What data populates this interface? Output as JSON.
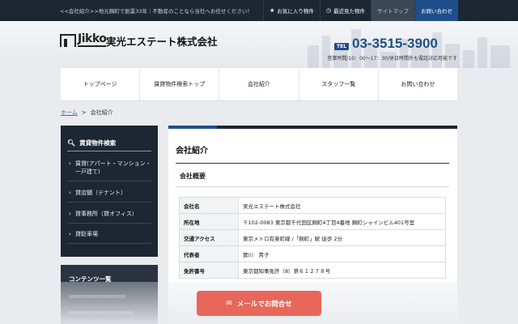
{
  "topbar": {
    "tagline": "<<会社紹介>>地元麹町で創業33年｜不動産のことなら当社へお任せください！",
    "favorites": "お気に入り物件",
    "recent": "最近見た物件",
    "sitemap": "サイトマップ",
    "contact": "お問い合わせ"
  },
  "header": {
    "logo_text": "Jikko",
    "company_name": "実光エステート株式会社",
    "tel_label": "TEL",
    "tel_number": "03-3515-3900",
    "hours": "営業時間/10：00～17：30/休日時間外も電話対応可能です"
  },
  "nav": [
    {
      "label": "トップページ"
    },
    {
      "label": "賃貸物件検索トップ"
    },
    {
      "label": "会社紹介"
    },
    {
      "label": "スタッフ一覧"
    },
    {
      "label": "お問い合わせ"
    }
  ],
  "breadcrumb": {
    "home": "ホーム",
    "sep": ">",
    "current": "会社紹介"
  },
  "sidebar": {
    "title": "賃貸物件検索",
    "items": [
      {
        "label": "賃貸(アパート・マンション・一戸建て)"
      },
      {
        "label": "貸店舗（テナント）"
      },
      {
        "label": "貸事務所（貸オフィス）"
      },
      {
        "label": "貸駐車場"
      }
    ],
    "contents_title": "コンテンツ一覧"
  },
  "main": {
    "page_title": "会社紹介",
    "section_title": "会社概要",
    "rows": [
      {
        "key": "会社名",
        "value": "実光エステート株式会社"
      },
      {
        "key": "所在地",
        "value": "〒102-0083 東京都千代田区麹町4丁目4番地 麹町シャインビル401号室"
      },
      {
        "key": "交通アクセス",
        "value": "東京メトロ有楽町線 /「麹町」駅 徒歩 2分"
      },
      {
        "key": "代表者",
        "value": "實川　貴子"
      },
      {
        "key": "免許番号",
        "value": "東京都知事免許（8）第６１２７８号"
      }
    ]
  },
  "cta": {
    "label": "メールでお問合せ"
  },
  "colors": {
    "dark": "#1c2733",
    "accent": "#1f4e8a",
    "cta": "#e8665a"
  }
}
